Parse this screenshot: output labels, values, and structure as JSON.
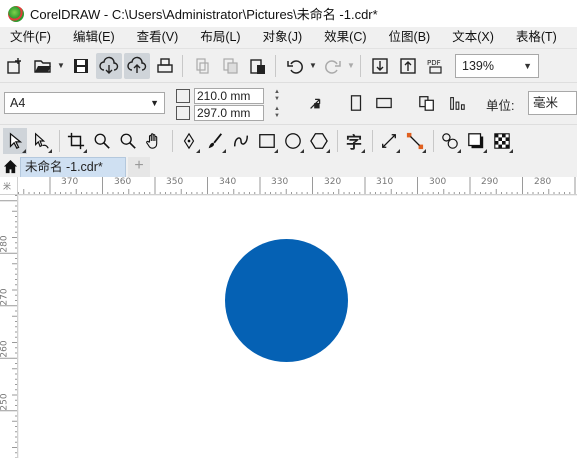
{
  "window": {
    "title": "CorelDRAW - C:\\Users\\Administrator\\Pictures\\未命名 -1.cdr*"
  },
  "menu": [
    "文件(F)",
    "编辑(E)",
    "查看(V)",
    "布局(L)",
    "对象(J)",
    "效果(C)",
    "位图(B)",
    "文本(X)",
    "表格(T)"
  ],
  "toolbar": {
    "zoom": "139%"
  },
  "property_bar": {
    "page_size": "A4",
    "width": "210.0 mm",
    "height": "297.0 mm",
    "units_label": "单位:",
    "units_value": "毫米"
  },
  "toolbox": {
    "text_tool_glyph": "字"
  },
  "tabs": {
    "document": "未命名 -1.cdr*",
    "add": "+"
  },
  "ruler": {
    "corner": "米",
    "horizontal": [
      "370",
      "360",
      "350",
      "340",
      "330",
      "320",
      "310",
      "300",
      "290",
      "280"
    ],
    "vertical": [
      "280",
      "270",
      "260",
      "250"
    ]
  },
  "canvas": {
    "shape": {
      "type": "circle",
      "fill": "#0561b4"
    }
  },
  "colors": {
    "accent": "#0561b4",
    "tab_active": "#cfe0f2"
  }
}
